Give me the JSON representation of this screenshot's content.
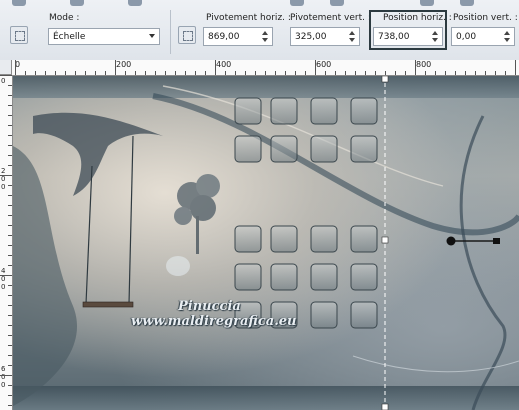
{
  "toolbar": {
    "mode_label": "Mode :",
    "mode_value": "Échelle",
    "pivot_h_label": "Pivotement horiz. :",
    "pivot_h_value": "869,00",
    "pivot_v_label": "Pivotement vert. :",
    "pivot_v_value": "325,00",
    "pos_h_label": "Position horiz. :",
    "pos_h_value": "738,00",
    "pos_v_label": "Position vert. :",
    "pos_v_value": "0,00"
  },
  "ruler": {
    "h_labels": [
      "0",
      "200",
      "400",
      "600",
      "800"
    ],
    "v_labels": [
      "0",
      "2",
      "0",
      "0",
      "4",
      "0",
      "0",
      "6",
      "0",
      "0"
    ]
  },
  "canvas": {
    "watermark_line1": "Pinuccia",
    "watermark_line2": "www.maldiregrafica.eu"
  },
  "icons": [
    "pick-tool-icon",
    "pivot-icon",
    "swing-icon",
    "tree-icon"
  ],
  "colors": {
    "highlight_border": "#2c3a40",
    "guide": "#ffffff"
  }
}
